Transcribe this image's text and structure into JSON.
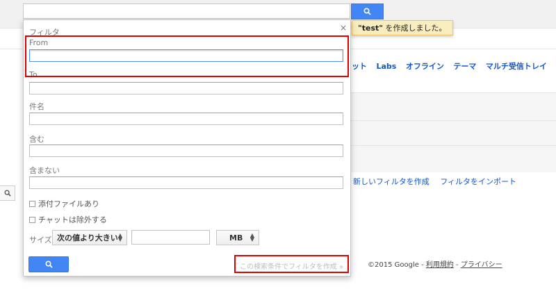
{
  "toast": {
    "quoted": "\"test\"",
    "rest": " を作成しました。"
  },
  "settings_tabs": [
    "ット",
    "Labs",
    "オフライン",
    "テーマ",
    "マルチ受信トレイ"
  ],
  "filter_links": {
    "create": "新しいフィルタを作成",
    "import": "フィルタをインポート"
  },
  "footer": {
    "copyright": "©2015 Google - ",
    "terms": "利用規約",
    "dash": " - ",
    "privacy": "プライバシー"
  },
  "panel": {
    "title": "フィルタ",
    "close": "×",
    "from_label": "From",
    "to_label": "To",
    "subject_label": "件名",
    "has_words_label": "含む",
    "doesnt_have_label": "含まない",
    "has_attachment": "添付ファイルあり",
    "exclude_chats": "チャットは除外する",
    "size_label": "サイズ",
    "size_operator": "次の値より大きい",
    "size_unit": "MB",
    "create_filter_link": "この検索条件でフィルタを作成 »"
  },
  "colors": {
    "accent_blue": "#4285f4",
    "annotation_red": "#e00000",
    "link_blue": "#1155cc"
  },
  "icons": {
    "search": "search-icon",
    "close": "close-icon",
    "select_arrows": "updown-arrows-icon"
  }
}
